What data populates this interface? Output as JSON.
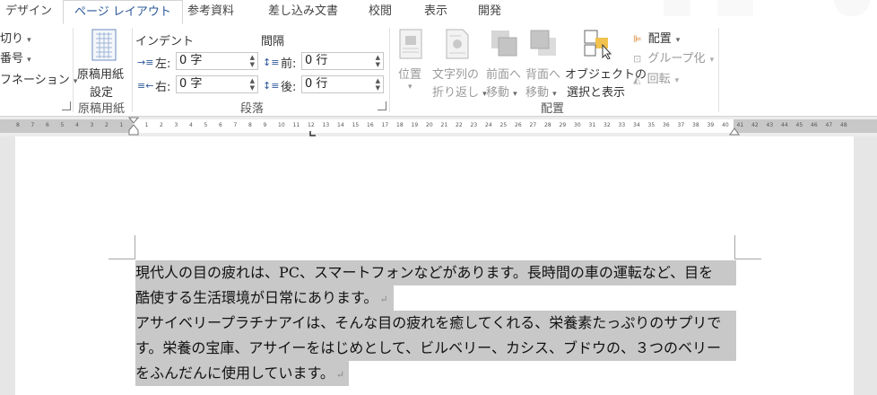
{
  "tabs": [
    {
      "label": "デザイン",
      "active": false
    },
    {
      "label": "ページ レイアウト",
      "active": true
    },
    {
      "label": "参考資料",
      "active": false
    },
    {
      "label": "差し込み文書",
      "active": false
    },
    {
      "label": "校閲",
      "active": false
    },
    {
      "label": "表示",
      "active": false
    },
    {
      "label": "開発",
      "active": false
    }
  ],
  "page_setup": {
    "items": [
      "切り",
      "番号",
      "フネーション"
    ],
    "genkou_line1": "原稿用紙",
    "genkou_line2": "設定",
    "group_label": "原稿用紙"
  },
  "paragraph": {
    "indent_label": "インデント",
    "spacing_label": "間隔",
    "left_label": "左:",
    "right_label": "右:",
    "before_label": "前:",
    "after_label": "後:",
    "left_value": "0 字",
    "right_value": "0 字",
    "before_value": "0 行",
    "after_value": "0 行",
    "group_label": "段落"
  },
  "arrange": {
    "position_label": "位置",
    "wrap_line1": "文字列の",
    "wrap_line2": "折り返し",
    "forward_line1": "前面へ",
    "forward_line2": "移動",
    "backward_line1": "背面へ",
    "backward_line2": "移動",
    "select_line1": "オブジェクトの",
    "select_line2": "選択と表示",
    "align_label": "配置",
    "group_obj_label": "グループ化",
    "rotate_label": "回転",
    "group_label": "配置"
  },
  "ruler": {
    "left_labels": [
      "8",
      "7",
      "6",
      "5",
      "4",
      "3",
      "2",
      "1"
    ],
    "right_labels": [
      "1",
      "2",
      "3",
      "4",
      "5",
      "6",
      "7",
      "8",
      "9",
      "10",
      "11",
      "12",
      "13",
      "14",
      "15",
      "16",
      "17",
      "18",
      "19",
      "20",
      "21",
      "22",
      "23",
      "24",
      "25",
      "26",
      "27",
      "28",
      "29",
      "30",
      "31",
      "32",
      "33",
      "34",
      "35",
      "36",
      "37",
      "38",
      "39",
      "40",
      "41",
      "42",
      "43",
      "44",
      "45",
      "46",
      "47",
      "48"
    ]
  },
  "document": {
    "lines": [
      "現代人の目の疲れは、PC、スマートフォンなどがあります。長時間の車の運転など、目を",
      "酷使する生活環境が日常にあります。",
      "アサイベリープラチナアイは、そんな目の疲れを癒してくれる、栄養素たっぷりのサプリで",
      "す。栄養の宝庫、アサイーをはじめとして、ビルベリー、カシス、ブドウの、３つのベリー",
      "をふんだんに使用しています。"
    ],
    "paragraph_mark": "↵"
  },
  "colors": {
    "accent": "#2b579a",
    "selection": "#c8c8c8",
    "ribbon_bg": "#ffffff",
    "doc_bg": "#e6e6e6"
  }
}
